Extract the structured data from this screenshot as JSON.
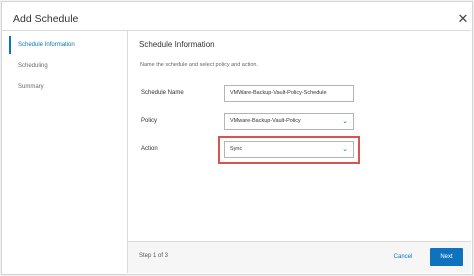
{
  "dialog": {
    "title": "Add Schedule",
    "close_icon": "close-icon"
  },
  "nav": {
    "items": [
      {
        "label": "Schedule Information",
        "active": true
      },
      {
        "label": "Scheduling",
        "active": false
      },
      {
        "label": "Summary",
        "active": false
      }
    ]
  },
  "panel": {
    "title": "Schedule Information",
    "description": "Name the schedule and select policy and action.",
    "fields": {
      "schedule_name": {
        "label": "Schedule Name",
        "value": "VMWare-Backup-Vault-Policy-Schedule"
      },
      "policy": {
        "label": "Policy",
        "value": "VMware-Backup-Vault-Policy"
      },
      "action": {
        "label": "Action",
        "value": "Sync"
      }
    }
  },
  "footer": {
    "step": "Step 1 of 3",
    "cancel_label": "Cancel",
    "next_label": "Next"
  },
  "colors": {
    "accent": "#0e73bf",
    "highlight": "#d9534f"
  }
}
